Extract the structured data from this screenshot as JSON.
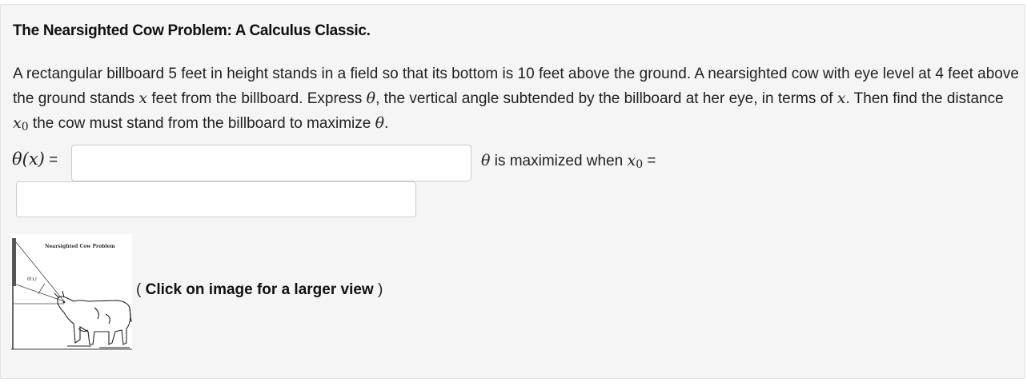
{
  "problem": {
    "title": "The Nearsighted Cow Problem: A Calculus Classic.",
    "text_1": "A rectangular billboard 5 feet in height stands in a field so that its bottom is 10 feet above the ground. A nearsighted cow with eye level at 4 feet above the ground stands ",
    "var_x": "x",
    "text_2": " feet from the billboard. Express ",
    "var_theta": "θ",
    "text_3": ", the vertical angle subtended by the billboard at her eye, in terms of ",
    "text_4": ". Then find the distance ",
    "var_x0_base": "x",
    "var_x0_sub": "0",
    "text_5": " the cow must stand from the billboard to maximize ",
    "text_6": "."
  },
  "answers": {
    "theta_label_math": "θ(x)",
    "theta_label_eq": " =",
    "theta_input_value": "",
    "max_label_theta": "θ",
    "max_label_text": " is maximized when ",
    "max_label_x": "x",
    "max_label_sub": "0",
    "max_label_eq": " =",
    "x0_input_value": ""
  },
  "figure": {
    "caption": "Nearsighted Cow Problem",
    "angle_label": "θ(x)",
    "hint_open": "( ",
    "hint_bold": "Click on image for a larger view",
    "hint_close": " )"
  }
}
